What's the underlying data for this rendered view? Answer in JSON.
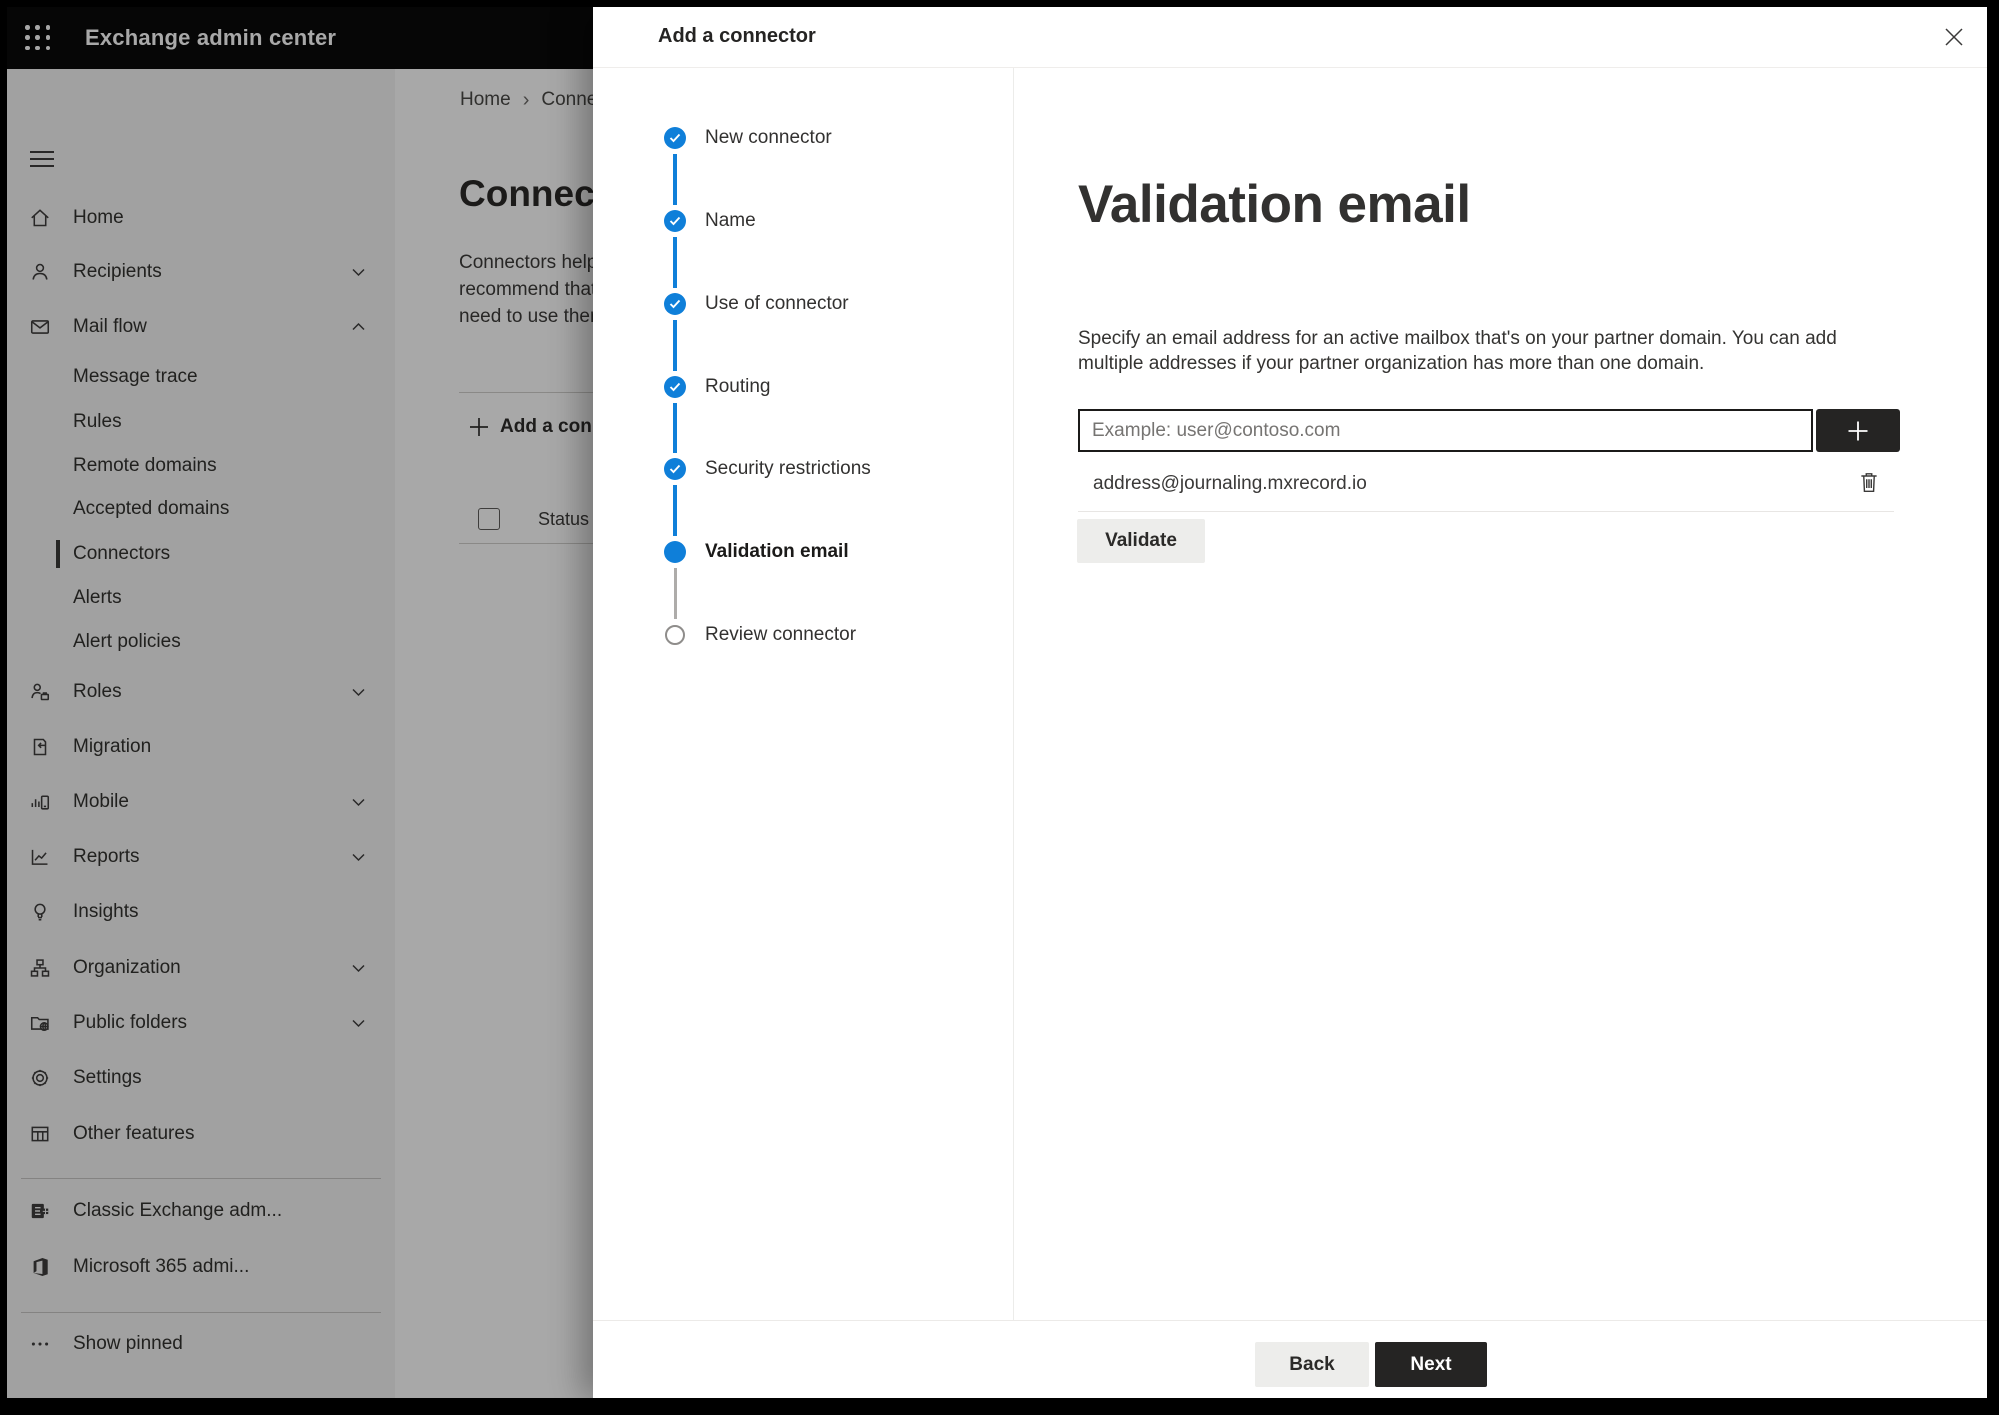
{
  "app_bar": {
    "title": "Exchange admin center"
  },
  "sidebar": {
    "items": [
      {
        "label": "Home",
        "icon": "home-icon"
      },
      {
        "label": "Recipients",
        "icon": "person-icon",
        "chevron": "down"
      },
      {
        "label": "Mail flow",
        "icon": "mail-icon",
        "chevron": "up",
        "expanded": true
      },
      {
        "label": "Message trace",
        "type": "sub"
      },
      {
        "label": "Rules",
        "type": "sub"
      },
      {
        "label": "Remote domains",
        "type": "sub"
      },
      {
        "label": "Accepted domains",
        "type": "sub"
      },
      {
        "label": "Connectors",
        "type": "sub",
        "selected": true
      },
      {
        "label": "Alerts",
        "type": "sub"
      },
      {
        "label": "Alert policies",
        "type": "sub"
      },
      {
        "label": "Roles",
        "icon": "roles-icon",
        "chevron": "down"
      },
      {
        "label": "Migration",
        "icon": "migration-icon"
      },
      {
        "label": "Mobile",
        "icon": "mobile-icon",
        "chevron": "down"
      },
      {
        "label": "Reports",
        "icon": "reports-icon",
        "chevron": "down"
      },
      {
        "label": "Insights",
        "icon": "lightbulb-icon"
      },
      {
        "label": "Organization",
        "icon": "org-icon",
        "chevron": "down"
      },
      {
        "label": "Public folders",
        "icon": "folder-globe-icon",
        "chevron": "down"
      },
      {
        "label": "Settings",
        "icon": "gear-icon"
      },
      {
        "label": "Other features",
        "icon": "grid-icon"
      },
      {
        "label": "Classic Exchange adm...",
        "icon": "exchange-icon"
      },
      {
        "label": "Microsoft 365 admi...",
        "icon": "office-icon"
      },
      {
        "label": "Show pinned",
        "icon": "ellipsis-icon"
      }
    ]
  },
  "background_page": {
    "breadcrumb": {
      "home": "Home",
      "separator": "›",
      "current": "Conne"
    },
    "title": "Connect",
    "description_lines": [
      "Connectors help",
      "recommend that",
      "need to use ther"
    ],
    "add_connector_label": "Add a conn",
    "table_header_status": "Status"
  },
  "panel": {
    "title": "Add a connector",
    "steps": [
      {
        "label": "New connector",
        "state": "complete"
      },
      {
        "label": "Name",
        "state": "complete"
      },
      {
        "label": "Use of connector",
        "state": "complete"
      },
      {
        "label": "Routing",
        "state": "complete"
      },
      {
        "label": "Security restrictions",
        "state": "complete"
      },
      {
        "label": "Validation email",
        "state": "current"
      },
      {
        "label": "Review connector",
        "state": "upcoming"
      }
    ],
    "content": {
      "heading": "Validation email",
      "description_lines": [
        "Specify an email address for an active mailbox that's on your partner domain. You can add",
        "multiple addresses if your partner organization has more than one domain."
      ],
      "email_input_placeholder": "Example: user@contoso.com",
      "address_list": [
        {
          "email": "address@journaling.mxrecord.io"
        }
      ],
      "validate_button": "Validate"
    },
    "footer": {
      "back_button": "Back",
      "next_button": "Next"
    }
  },
  "colors": {
    "accent_blue": "#0f7fd9",
    "dark_button": "#252423",
    "appbar_bg": "#0a0a0a",
    "sidebar_bg": "#f4f4f4",
    "dim_overlay": "rgba(0,0,0,0.34)"
  }
}
